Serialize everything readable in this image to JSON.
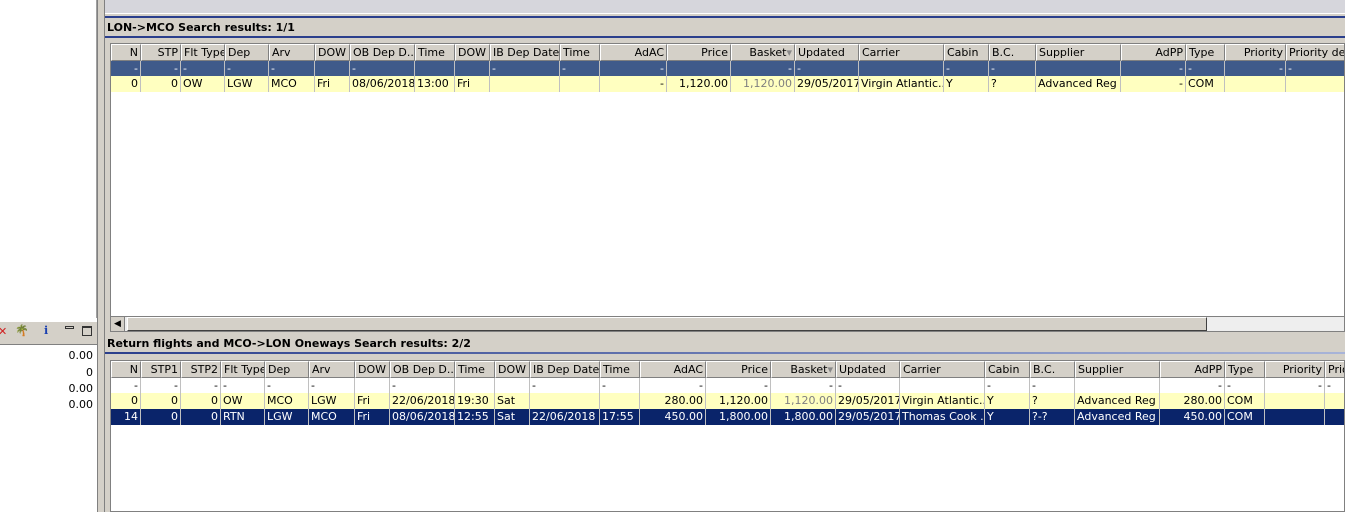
{
  "left_panel": {
    "values": [
      "0.00",
      "0",
      "0.00",
      "0.00"
    ]
  },
  "outbound": {
    "title": "LON->MCO Search results: 1/1",
    "columns": [
      "N",
      "STP",
      "Flt Type",
      "Dep",
      "Arv",
      "DOW",
      "OB Dep D...",
      "Time",
      "DOW",
      "IB Dep Date",
      "Time",
      "AdAC",
      "Price",
      "Basket",
      "Updated",
      "Carrier",
      "Cabin",
      "B.C.",
      "Supplier",
      "AdPP",
      "Type",
      "Priority",
      "Priority desc"
    ],
    "filter": [
      "-",
      "-",
      "-",
      "-",
      "-",
      "",
      "-",
      "",
      "",
      "-",
      "-",
      "-",
      "",
      "-",
      "-",
      "",
      "-",
      "-",
      "",
      "-",
      "-",
      "-",
      "-"
    ],
    "rows": [
      [
        "0",
        "0",
        "OW",
        "LGW",
        "MCO",
        "Fri",
        "08/06/2018",
        "13:00",
        "Fri",
        "",
        "",
        "-",
        "1,120.00",
        "1,120.00",
        "29/05/2017",
        "Virgin Atlantic...",
        "Y",
        "?",
        "Advanced Reg",
        "-",
        "COM",
        "",
        ""
      ]
    ]
  },
  "returns": {
    "title": "Return flights and MCO->LON Oneways Search results: 2/2",
    "columns": [
      "N",
      "STP1",
      "STP2",
      "Flt Type",
      "Dep",
      "Arv",
      "DOW",
      "OB Dep D...",
      "Time",
      "DOW",
      "IB Dep Date",
      "Time",
      "AdAC",
      "Price",
      "Basket",
      "Updated",
      "Carrier",
      "Cabin",
      "B.C.",
      "Supplier",
      "AdPP",
      "Type",
      "Priority",
      "Prio"
    ],
    "filter": [
      "-",
      "-",
      "-",
      "-",
      "-",
      "-",
      "",
      "-",
      "",
      "",
      "-",
      "-",
      "-",
      "-",
      "-",
      "-",
      "",
      "-",
      "-",
      "",
      "-",
      "-",
      "-",
      "-"
    ],
    "rows": [
      [
        "0",
        "0",
        "0",
        "OW",
        "MCO",
        "LGW",
        "Fri",
        "22/06/2018",
        "19:30",
        "Sat",
        "",
        "",
        "280.00",
        "1,120.00",
        "1,120.00",
        "29/05/2017",
        "Virgin Atlantic...",
        "Y",
        "?",
        "Advanced Reg",
        "280.00",
        "COM",
        "",
        ""
      ],
      [
        "14",
        "0",
        "0",
        "RTN",
        "LGW",
        "MCO",
        "Fri",
        "08/06/2018",
        "12:55",
        "Sat",
        "22/06/2018",
        "17:55",
        "450.00",
        "1,800.00",
        "1,800.00",
        "29/05/2017",
        "Thomas Cook ...",
        "Y",
        "?-?",
        "Advanced Reg",
        "450.00",
        "COM",
        "",
        ""
      ]
    ]
  },
  "colors": {
    "filter_bg": "#3f5a8a",
    "row_bg": "#ffffc0",
    "selected_bg": "#0a246a"
  }
}
